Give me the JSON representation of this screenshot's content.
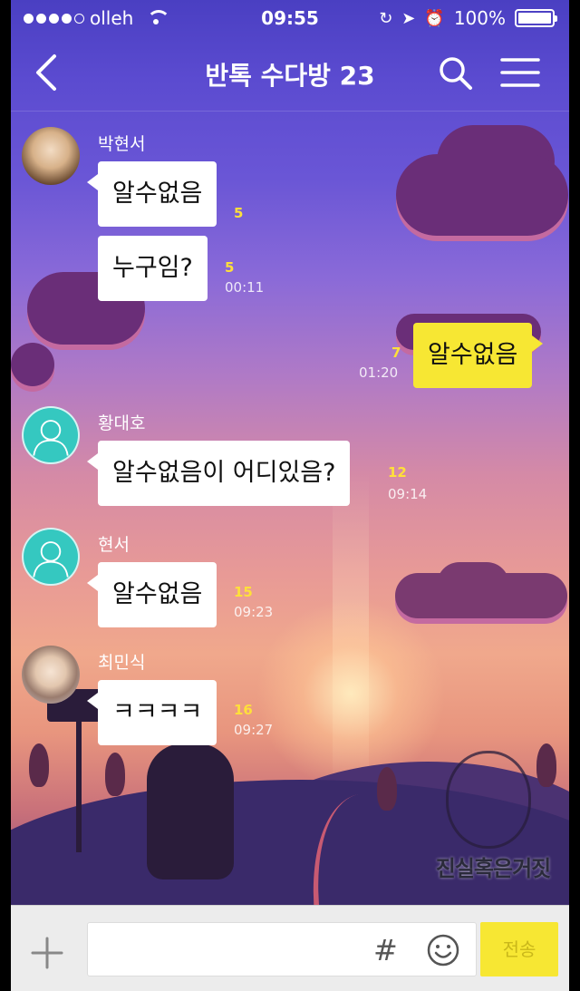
{
  "status_bar": {
    "carrier": "olleh",
    "time": "09:55",
    "battery": "100%"
  },
  "header": {
    "title": "반톡 수다방 23"
  },
  "messages": [
    {
      "sender": "박현서",
      "text": "알수없음",
      "count": "5",
      "time": ""
    },
    {
      "sender": "",
      "text": "누구임?",
      "count": "5",
      "time": "00:11"
    },
    {
      "sender": "",
      "text": "알수없음",
      "count": "7",
      "time": "01:20",
      "mine": true
    },
    {
      "sender": "황대호",
      "text": "알수없음이 어디있음?",
      "count": "12",
      "time": "09:14"
    },
    {
      "sender": "현서",
      "text": "알수없음",
      "count": "15",
      "time": "09:23"
    },
    {
      "sender": "최민식",
      "text": "ㅋㅋㅋㅋ",
      "count": "16",
      "time": "09:27"
    }
  ],
  "watermark": {
    "text": "진실혹은거짓"
  },
  "input_bar": {
    "hash_symbol": "#",
    "send_label": "전송"
  },
  "colors": {
    "my_bubble": "#f7e733",
    "other_bubble": "#ffffff",
    "read_count": "#ffe03a",
    "default_avatar": "#35c8c0"
  }
}
